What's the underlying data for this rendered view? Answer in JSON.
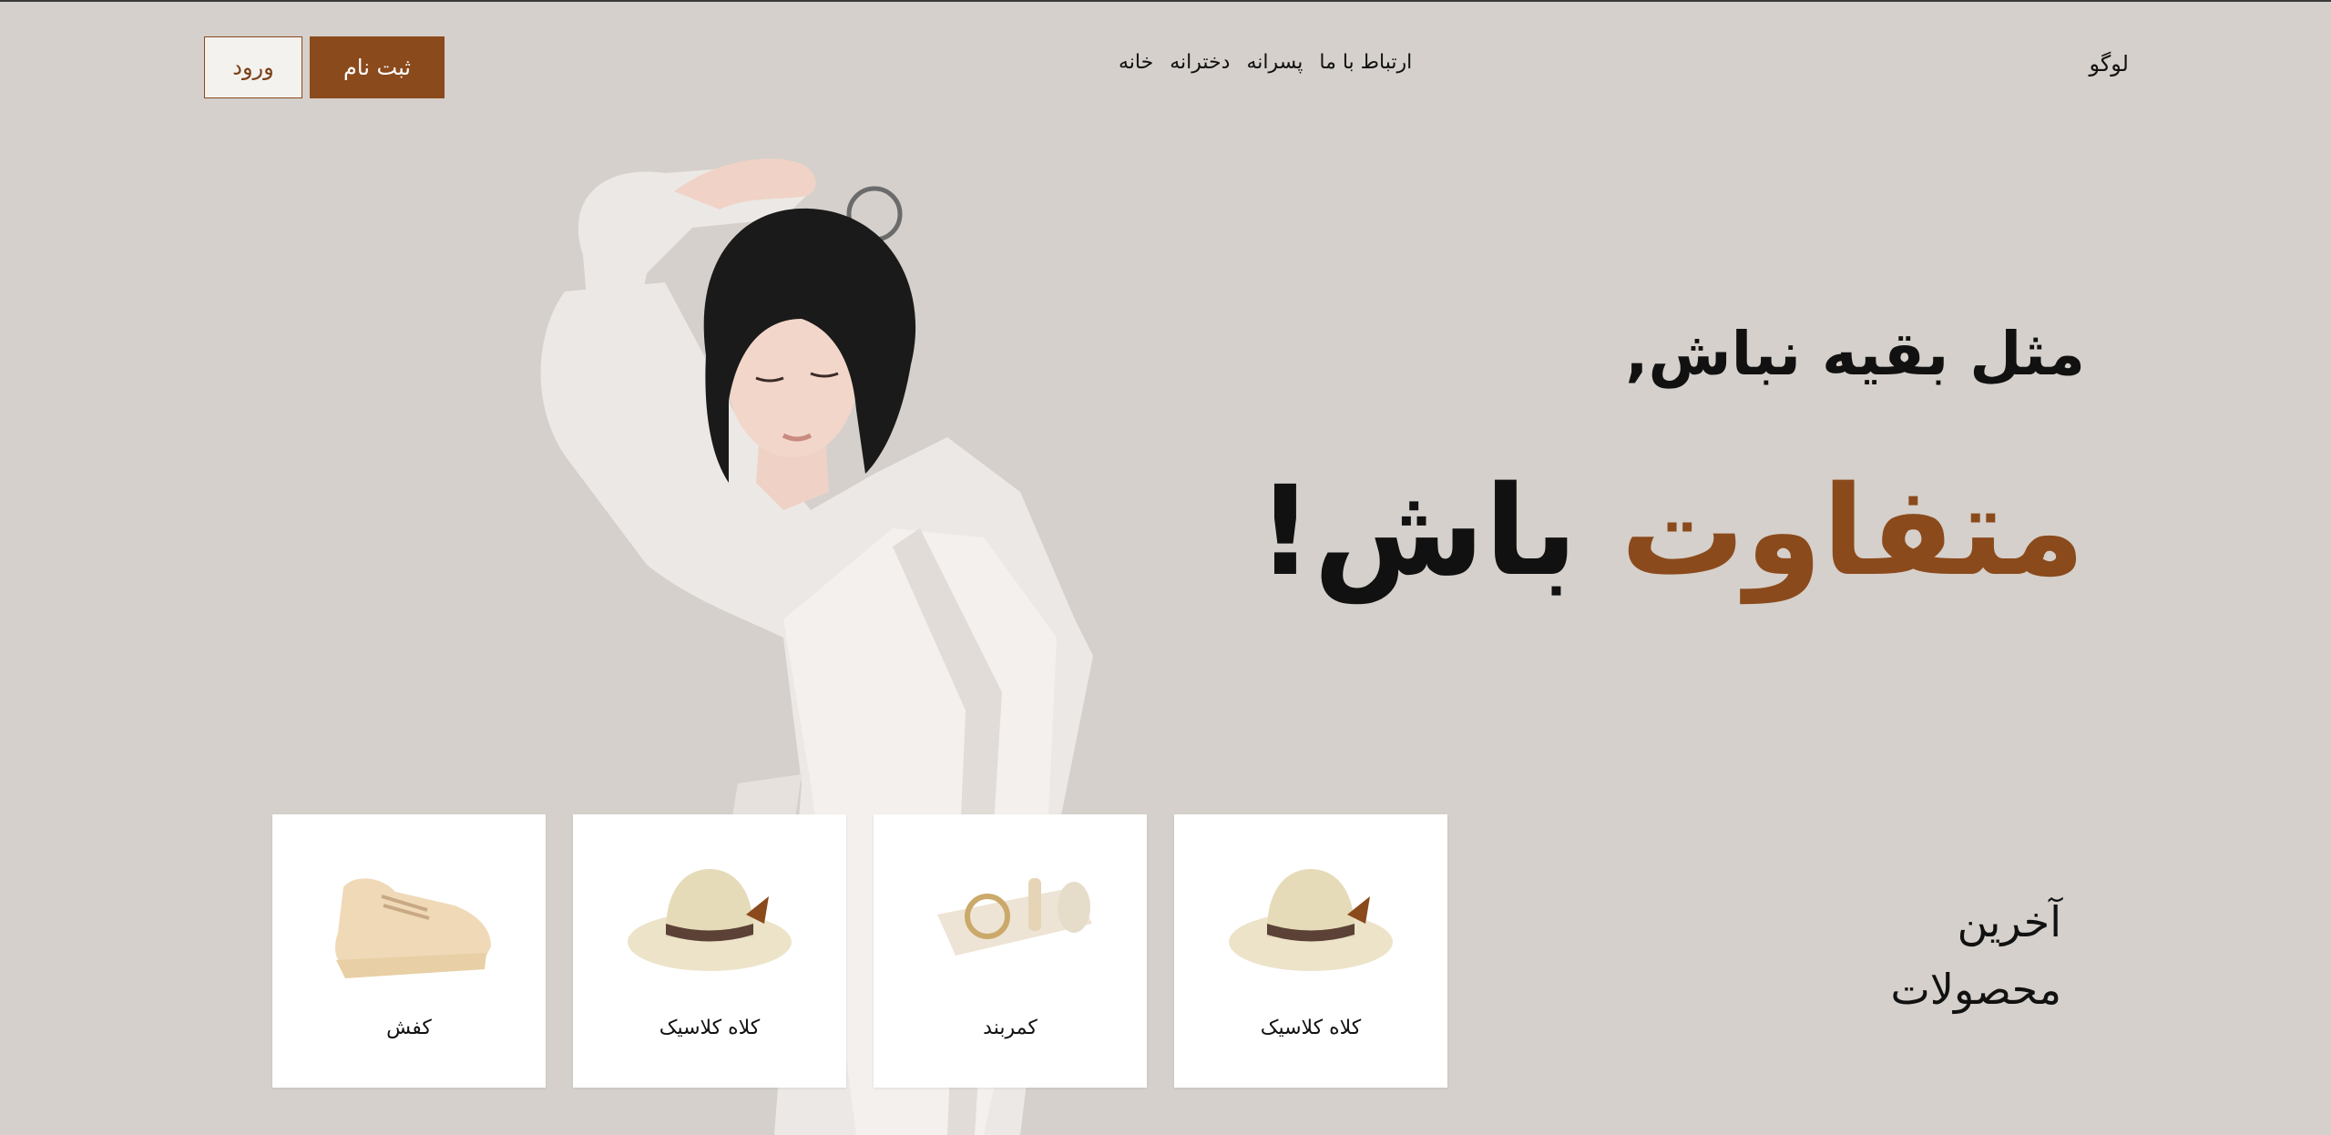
{
  "header": {
    "logo": "لوگو",
    "nav": [
      "خانه",
      "دخترانه",
      "پسرانه",
      "ارتباط با ما"
    ],
    "login_label": "ورود",
    "signup_label": "ثبت نام"
  },
  "hero": {
    "line1": "مثل بقیه نباش,",
    "line2_accent": "متفاوت",
    "line2_rest": "باش!"
  },
  "latest": {
    "line1": "آخرین",
    "line2": "محصولات"
  },
  "products": [
    {
      "label": "کلاه کلاسیک",
      "icon": "hat-icon"
    },
    {
      "label": "کمربند",
      "icon": "belt-icon"
    },
    {
      "label": "کلاه کلاسیک",
      "icon": "hat-icon"
    },
    {
      "label": "کفش",
      "icon": "sneaker-icon"
    }
  ],
  "colors": {
    "background": "#d5d0cb",
    "accent": "#8b4a1c",
    "card": "#ffffff"
  }
}
